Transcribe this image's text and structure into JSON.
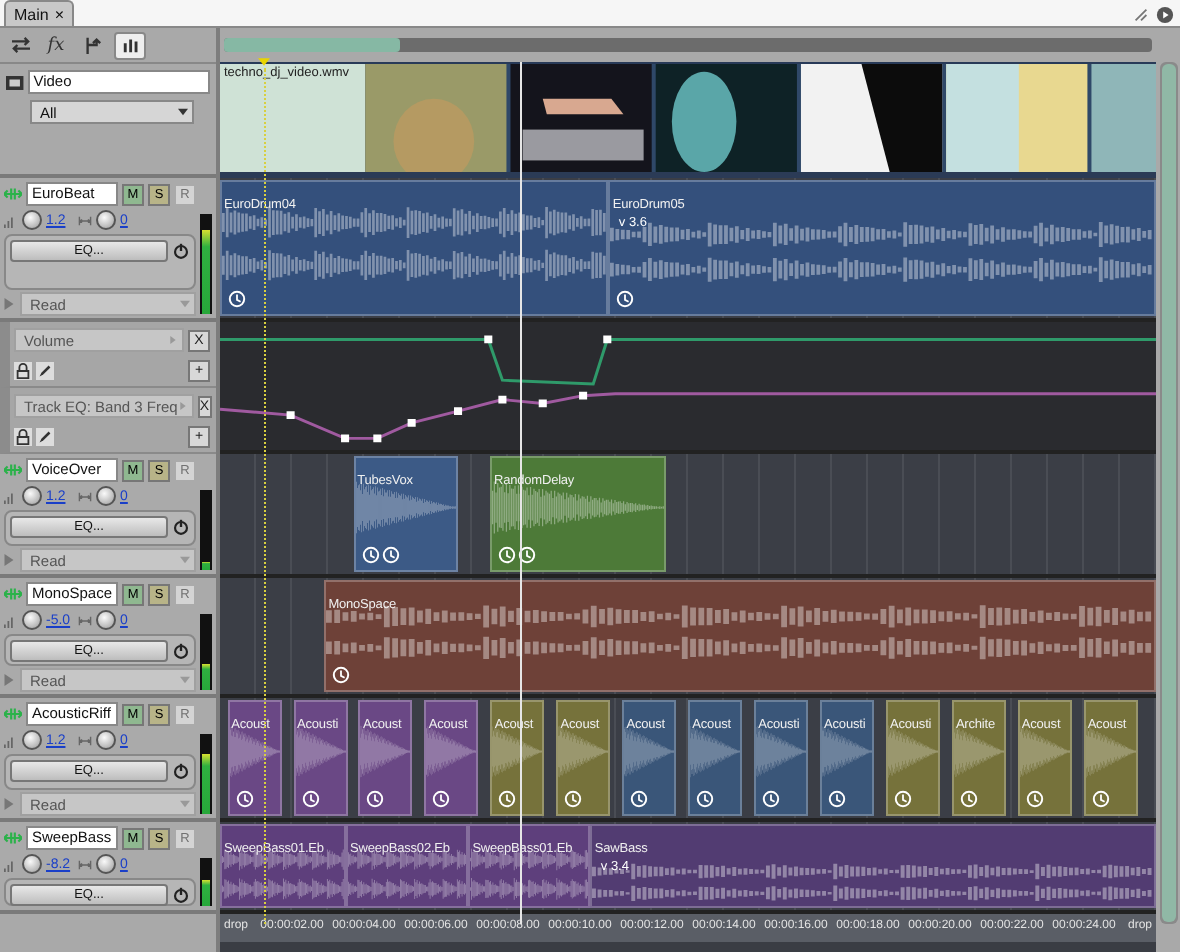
{
  "tab": {
    "label": "Main",
    "close": "×"
  },
  "toolbar": [
    {
      "kind": "swap",
      "selected": false
    },
    {
      "kind": "fx",
      "label": "fx",
      "selected": false
    },
    {
      "kind": "branch",
      "selected": false
    },
    {
      "kind": "meters",
      "selected": true
    }
  ],
  "video_track": {
    "name": "Video",
    "filter": "All",
    "clip_label": "techno_dj_video.wmv"
  },
  "tracks": [
    {
      "name": "EuroBeat",
      "kind": "stereo",
      "mute": "M",
      "solo": "S",
      "record": {
        "label": "R",
        "disabled": true
      },
      "volume": "1.2",
      "pan": "0",
      "eq": "EQ...",
      "automation_mode": "Read",
      "level": 0.85,
      "automation_lanes": [
        {
          "parameter": "Volume",
          "remove": "X",
          "add": "+"
        },
        {
          "parameter": "Track EQ: Band 3 Freq",
          "remove": "X",
          "add": "+"
        }
      ],
      "clips": [
        {
          "label": "EuroDrum04",
          "color": "#34507c"
        },
        {
          "label": "EuroDrum05",
          "color": "#34507c",
          "version": "v 3.6"
        }
      ]
    },
    {
      "name": "VoiceOver",
      "kind": "mono",
      "mute": "M",
      "solo": "S",
      "record": {
        "label": "R",
        "disabled": true
      },
      "volume": "1.2",
      "pan": "0",
      "eq": "EQ...",
      "automation_mode": "Read",
      "level": 0.1,
      "clips": [
        {
          "label": "TubesVox",
          "color": "#3c5a86"
        },
        {
          "label": "RandomDelay",
          "color": "#4d7a38"
        }
      ]
    },
    {
      "name": "MonoSpace",
      "kind": "stereo",
      "mute": "M",
      "solo": "S",
      "record": {
        "label": "R",
        "disabled": true
      },
      "volume": "-5.0",
      "pan": "0",
      "eq": "EQ...",
      "automation_mode": "Read",
      "level": 0.35,
      "clips": [
        {
          "label": "MonoSpace",
          "color": "#6e4138"
        }
      ]
    },
    {
      "name": "AcousticRiff",
      "kind": "mono",
      "mute": "M",
      "solo": "S",
      "record": {
        "label": "R",
        "disabled": true
      },
      "volume": "1.2",
      "pan": "0",
      "eq": "EQ...",
      "automation_mode": "Read",
      "level": 0.75,
      "clips": [
        {
          "label": "Acoust",
          "color": "#6a4885"
        },
        {
          "label": "Acousti",
          "color": "#6a4885"
        },
        {
          "label": "Acoust",
          "color": "#6a4885"
        },
        {
          "label": "Acoust",
          "color": "#6a4885"
        },
        {
          "label": "Acoust",
          "color": "#76723b"
        },
        {
          "label": "Acoust",
          "color": "#76723b"
        },
        {
          "label": "Acoust",
          "color": "#3a5679"
        },
        {
          "label": "Acoust",
          "color": "#3a5679"
        },
        {
          "label": "Acousti",
          "color": "#3a5679"
        },
        {
          "label": "Acousti",
          "color": "#3a5679"
        },
        {
          "label": "Acousti",
          "color": "#76723b"
        },
        {
          "label": "Archite",
          "color": "#76723b"
        },
        {
          "label": "Acoust",
          "color": "#76723b"
        },
        {
          "label": "Acoust",
          "color": "#76723b"
        }
      ]
    },
    {
      "name": "SweepBass",
      "kind": "stereo",
      "mute": "M",
      "solo": "S",
      "record": {
        "label": "R",
        "disabled": true
      },
      "volume": "-8.2",
      "pan": "0",
      "eq": "EQ...",
      "level": 0.55,
      "clips": [
        {
          "label": "SweepBass01.Eb",
          "color": "#5e3f7c"
        },
        {
          "label": "SweepBass02.Eb",
          "color": "#5e3f7c"
        },
        {
          "label": "SweepBass01.Eb",
          "color": "#5e3f7c"
        },
        {
          "label": "SawBass",
          "color": "#523c72",
          "version": "v 3.4"
        }
      ]
    }
  ],
  "ruler": [
    "drop",
    "00:00:02.00",
    "00:00:04.00",
    "00:00:06.00",
    "00:00:08.00",
    "00:00:10.00",
    "00:00:12.00",
    "00:00:14.00",
    "00:00:16.00",
    "00:00:18.00",
    "00:00:20.00",
    "00:00:22.00",
    "00:00:24.00",
    "drop"
  ]
}
